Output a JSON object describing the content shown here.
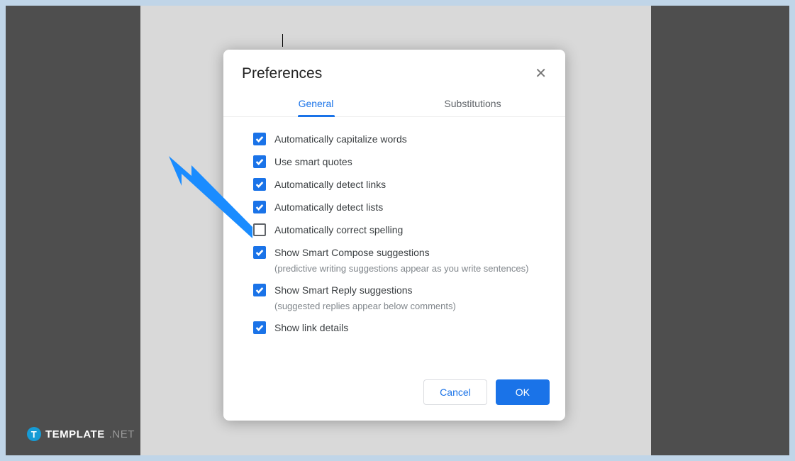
{
  "dialog": {
    "title": "Preferences",
    "tabs": {
      "general": "General",
      "substitutions": "Substitutions"
    },
    "options": [
      {
        "label": "Automatically capitalize words",
        "checked": true
      },
      {
        "label": "Use smart quotes",
        "checked": true
      },
      {
        "label": "Automatically detect links",
        "checked": true
      },
      {
        "label": "Automatically detect lists",
        "checked": true
      },
      {
        "label": "Automatically correct spelling",
        "checked": false
      },
      {
        "label": "Show Smart Compose suggestions",
        "checked": true,
        "desc": "(predictive writing suggestions appear as you write sentences)"
      },
      {
        "label": "Show Smart Reply suggestions",
        "checked": true,
        "desc": "(suggested replies appear below comments)"
      },
      {
        "label": "Show link details",
        "checked": true
      }
    ],
    "buttons": {
      "cancel": "Cancel",
      "ok": "OK"
    }
  },
  "watermark": {
    "icon": "T",
    "brand": "TEMPLATE",
    "suffix": ".NET"
  }
}
